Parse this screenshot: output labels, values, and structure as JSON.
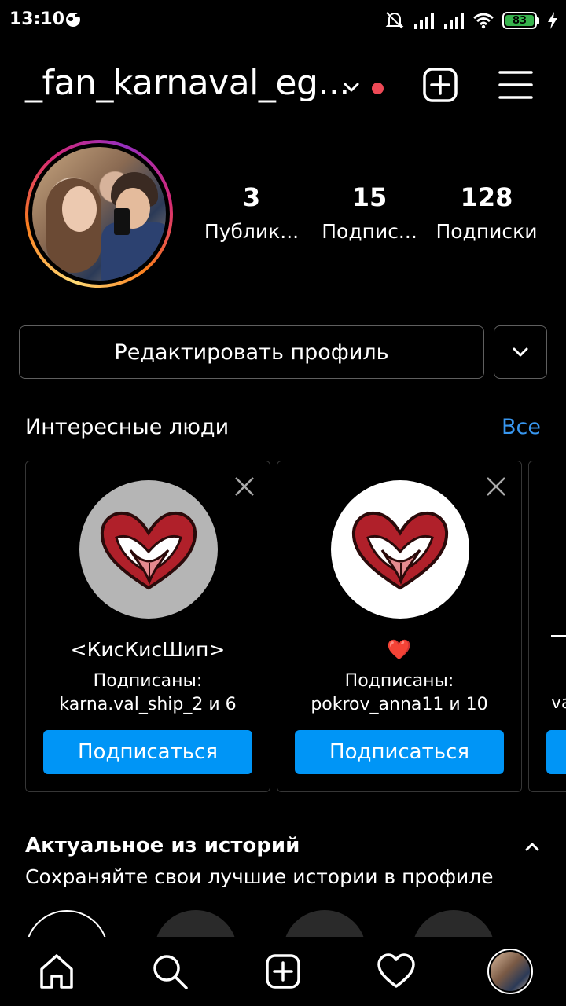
{
  "status_bar": {
    "time": "13:10",
    "battery": "83",
    "icons": [
      "notification-icon",
      "mute-icon",
      "signal-icon",
      "signal-icon",
      "wifi-icon",
      "battery-icon",
      "charging-icon"
    ]
  },
  "header": {
    "username": "_fan_karnaval_eg...",
    "icons": [
      "chevron-down-icon",
      "new-post-icon",
      "menu-icon"
    ]
  },
  "profile": {
    "stats": [
      {
        "value": "3",
        "label": "Публик..."
      },
      {
        "value": "15",
        "label": "Подпис..."
      },
      {
        "value": "128",
        "label": "Подписки"
      }
    ],
    "edit_label": "Редактировать профиль"
  },
  "suggestions": {
    "title": "Интересные люди",
    "see_all": "Все",
    "cards": [
      {
        "name": "<КисКисШип>",
        "sub_line1": "Подписаны:",
        "sub_line2": "karna.val_ship_2 и 6",
        "follow": "Подписаться"
      },
      {
        "name": "❤️",
        "sub_line1": "Подписаны:",
        "sub_line2": "pokrov_anna11 и 10",
        "follow": "Подписаться"
      }
    ],
    "partial_card": {
      "sub_line2": "va"
    }
  },
  "highlights": {
    "title": "Актуальное из историй",
    "subtitle": "Сохраняйте свои лучшие истории в профиле"
  },
  "nav": {
    "items": [
      "home-icon",
      "search-icon",
      "new-post-icon",
      "activity-heart-icon",
      "profile-avatar"
    ]
  },
  "colors": {
    "background": "#000000",
    "accent_blue": "#0095f6",
    "link_blue": "#3897f0",
    "notification_red": "#ed4956"
  }
}
